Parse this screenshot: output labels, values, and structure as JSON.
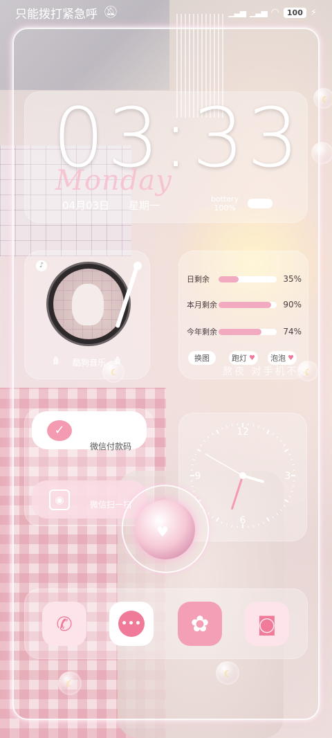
{
  "status_bar": {
    "emergency_text": "只能拨打紧急呼",
    "battery_level": "100",
    "signal_1": "HD",
    "signal_2": "HD"
  },
  "clock": {
    "time": "03:33",
    "day_name": "Monday",
    "date": "04月03日",
    "weekday": "星期一",
    "battery_label": "bottery",
    "battery_value": "100%"
  },
  "music": {
    "app_label": "酷狗音乐"
  },
  "stats": {
    "rows": [
      {
        "label": "日剩余",
        "percent": "35%",
        "fraction": 0.35
      },
      {
        "label": "本月剩余",
        "percent": "90%",
        "fraction": 0.9
      },
      {
        "label": "今年剩余",
        "percent": "74%",
        "fraction": 0.74
      }
    ],
    "buttons": {
      "change": "换图",
      "marquee": "跑灯",
      "bubble": "泡泡"
    },
    "overlay_text": "熬夜 对手机不好"
  },
  "wechat": {
    "pay_label": "微信付款码",
    "scan_label": "微信扫一扫"
  },
  "analog_clock": {
    "numbers": [
      "12",
      "3",
      "6",
      "9"
    ],
    "hour": 3,
    "minute": 33,
    "second": 50
  },
  "dock": {
    "apps": [
      "phone",
      "messages",
      "theme",
      "camera"
    ]
  },
  "colors": {
    "accent_pink": "#ef7b99",
    "bar_pink": "#f1aac0",
    "day_pink": "#f7c1d0"
  }
}
